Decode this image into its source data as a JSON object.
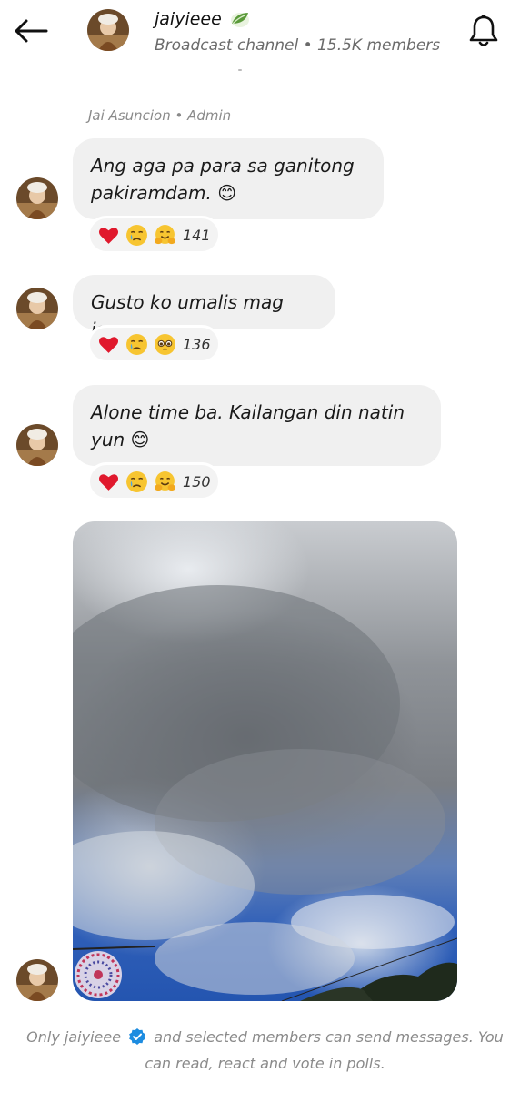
{
  "header": {
    "channel_name": "jaiyieee",
    "subtitle": "Broadcast channel • 15.5K members",
    "back_icon": "arrow-left-icon",
    "bell_icon": "bell-icon"
  },
  "feed": {
    "sender_label": "Jai Asuncion • Admin",
    "messages": [
      {
        "text": "Ang aga pa para sa ganitong pakiramdam. 😊",
        "reactions": [
          "heart",
          "crying-face",
          "hugging-face"
        ],
        "count": "141"
      },
      {
        "text": "Gusto ko umalis mag isa.",
        "reactions": [
          "heart",
          "crying-face",
          "pleading-face"
        ],
        "count": "136"
      },
      {
        "text": "Alone time ba. Kailangan din natin yun 😊",
        "reactions": [
          "heart",
          "crying-face",
          "hugging-face"
        ],
        "count": "150"
      }
    ]
  },
  "footer": {
    "text_before": "Only jaiyieee",
    "text_after": "and selected members can send messages. You can read, react and vote in polls."
  },
  "colors": {
    "bubble": "#f0f0f0",
    "verified_blue": "#1d8ce0",
    "heart_red": "#e0192d"
  }
}
